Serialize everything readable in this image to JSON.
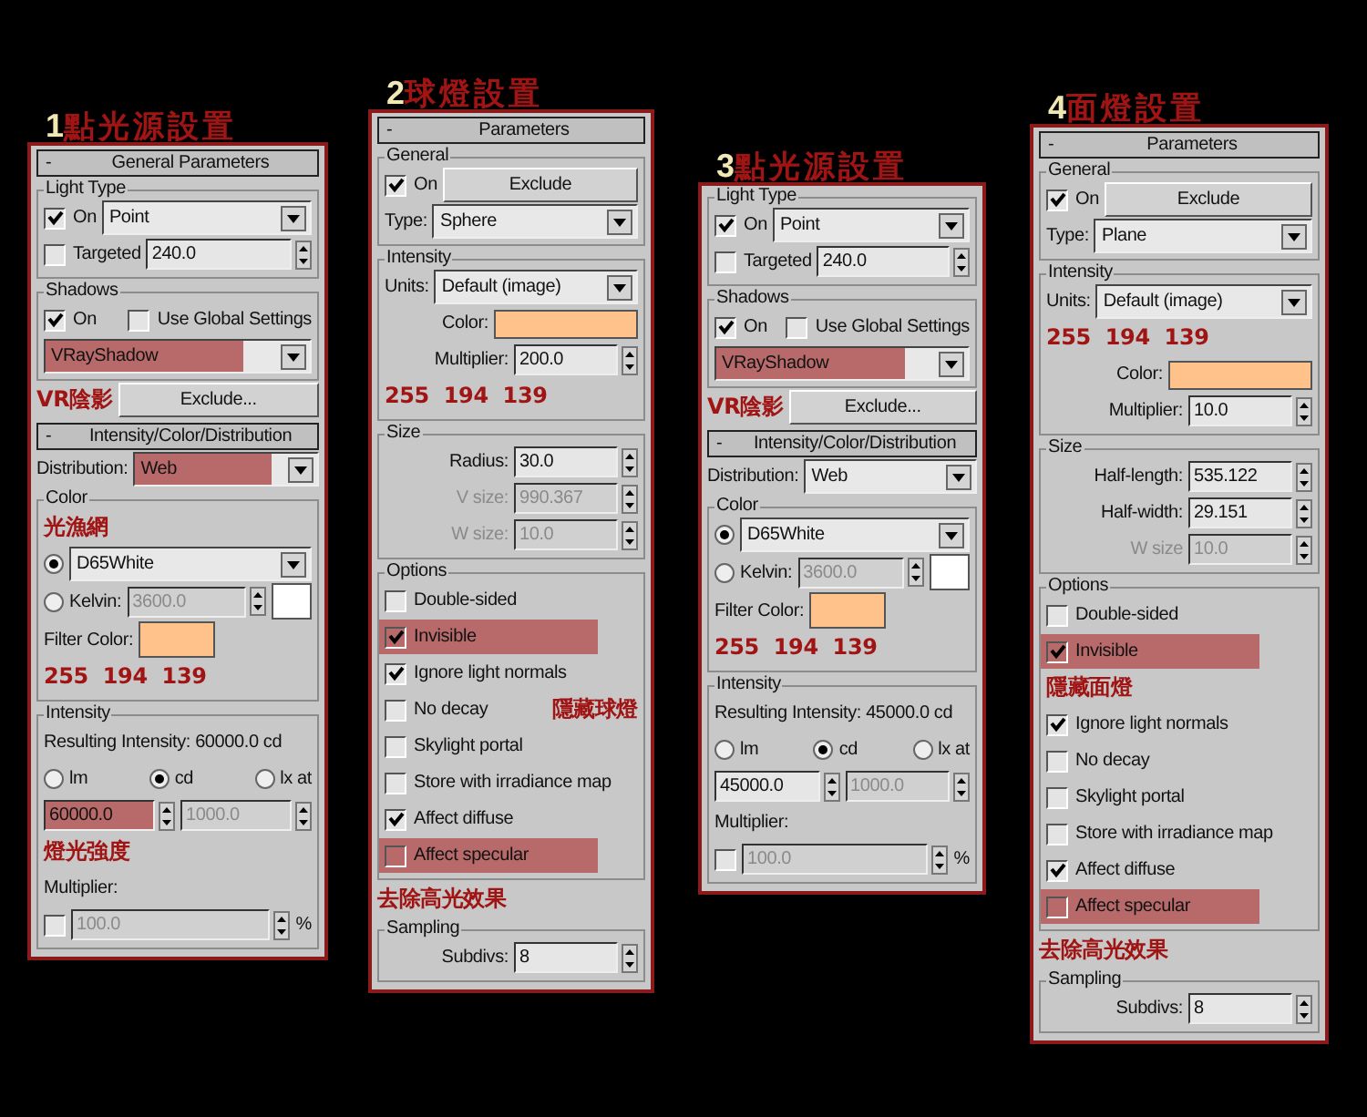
{
  "panels": [
    {
      "number": "1",
      "title": "點光源設置",
      "items": [
        {
          "kind": "rollout",
          "sign": "-",
          "title": "General Parameters"
        },
        {
          "kind": "group",
          "title": "Light Type",
          "lines": [
            {
              "controls": [
                {
                  "kind": "checkbox",
                  "label": "On",
                  "checked": true
                },
                {
                  "kind": "dropdown",
                  "value": "Point"
                }
              ]
            },
            {
              "controls": [
                {
                  "kind": "checkbox",
                  "label": "Targeted",
                  "checked": false
                },
                {
                  "kind": "spinner",
                  "value": "240.0"
                }
              ]
            }
          ]
        },
        {
          "kind": "group",
          "title": "Shadows",
          "lines": [
            {
              "controls": [
                {
                  "kind": "checkbox",
                  "label": "On",
                  "checked": true
                },
                {
                  "kind": "checkbox",
                  "label": "Use Global Settings",
                  "checked": false
                }
              ]
            },
            {
              "controls": [
                {
                  "kind": "dropdown",
                  "value": "VRayShadow",
                  "highlighted": true
                }
              ]
            }
          ]
        },
        {
          "kind": "row",
          "controls": [
            {
              "kind": "note",
              "text": "VR陰影"
            },
            {
              "kind": "button",
              "label": "Exclude..."
            }
          ]
        },
        {
          "kind": "rollout",
          "sign": "-",
          "title": "Intensity/Color/Distribution"
        },
        {
          "kind": "row",
          "controls": [
            {
              "kind": "dropdown",
              "label": "Distribution:",
              "value": "Web",
              "highlighted": true
            }
          ]
        },
        {
          "kind": "group",
          "title": "Color",
          "lines": [
            {
              "controls": [
                {
                  "kind": "note",
                  "text": "光漁網"
                }
              ]
            },
            {
              "controls": [
                {
                  "kind": "radio",
                  "selected": true
                },
                {
                  "kind": "dropdown",
                  "value": "D65White"
                }
              ]
            },
            {
              "controls": [
                {
                  "kind": "radio",
                  "label": "Kelvin:",
                  "selected": false
                },
                {
                  "kind": "spinner",
                  "value": "3600.0",
                  "disabled": true
                },
                {
                  "kind": "swatch",
                  "color": "#ffffff"
                }
              ]
            },
            {
              "controls": [
                {
                  "kind": "swatch",
                  "label": "Filter Color:",
                  "color": "#ffc28b"
                }
              ]
            },
            {
              "controls": [
                {
                  "kind": "note",
                  "text": "255  194  139"
                }
              ]
            }
          ]
        },
        {
          "kind": "group",
          "title": "Intensity",
          "lines": [
            {
              "controls": [
                {
                  "kind": "text",
                  "text": "Resulting Intensity: 60000.0 cd"
                }
              ]
            },
            {
              "controls": [
                {
                  "kind": "radio",
                  "label": "lm",
                  "selected": false
                },
                {
                  "kind": "radio",
                  "label": "cd",
                  "selected": true
                },
                {
                  "kind": "radio",
                  "label": "lx at",
                  "selected": false
                }
              ]
            },
            {
              "controls": [
                {
                  "kind": "spinner",
                  "value": "60000.0",
                  "highlighted": true
                },
                {
                  "kind": "spinner",
                  "value": "1000.0",
                  "disabled": true
                }
              ]
            },
            {
              "controls": [
                {
                  "kind": "note",
                  "text": "燈光強度"
                }
              ]
            },
            {
              "controls": [
                {
                  "kind": "text",
                  "text": "Multiplier:"
                }
              ]
            },
            {
              "controls": [
                {
                  "kind": "checkbox",
                  "checked": false
                },
                {
                  "kind": "spinner",
                  "value": "100.0",
                  "disabled": true
                },
                {
                  "kind": "text",
                  "text": "%"
                }
              ]
            }
          ]
        }
      ]
    },
    {
      "number": "2",
      "title": "球燈設置",
      "items": [
        {
          "kind": "rollout",
          "sign": "-",
          "title": "Parameters"
        },
        {
          "kind": "group",
          "title": "General",
          "lines": [
            {
              "controls": [
                {
                  "kind": "checkbox",
                  "label": "On",
                  "checked": true
                },
                {
                  "kind": "button",
                  "label": "Exclude"
                }
              ]
            },
            {
              "controls": [
                {
                  "kind": "dropdown",
                  "label": "Type:",
                  "value": "Sphere"
                }
              ]
            }
          ]
        },
        {
          "kind": "group",
          "title": "Intensity",
          "lines": [
            {
              "controls": [
                {
                  "kind": "dropdown",
                  "label": "Units:",
                  "value": "Default (image)"
                }
              ]
            },
            {
              "controls": [
                {
                  "kind": "color_field",
                  "label": "Color:",
                  "color": "#ffc28b"
                }
              ]
            },
            {
              "controls": [
                {
                  "kind": "field",
                  "label": "Multiplier:",
                  "value": "200.0"
                }
              ]
            },
            {
              "controls": [
                {
                  "kind": "note",
                  "text": "255  194  139"
                }
              ]
            }
          ]
        },
        {
          "kind": "group",
          "title": "Size",
          "lines": [
            {
              "controls": [
                {
                  "kind": "field",
                  "label": "Radius:",
                  "value": "30.0"
                }
              ]
            },
            {
              "controls": [
                {
                  "kind": "field",
                  "label": "V size:",
                  "value": "990.367",
                  "disabled": true
                }
              ]
            },
            {
              "controls": [
                {
                  "kind": "field",
                  "label": "W size:",
                  "value": "10.0",
                  "disabled": true
                }
              ]
            }
          ]
        },
        {
          "kind": "group",
          "title": "Options",
          "lines": [
            {
              "controls": [
                {
                  "kind": "checkbox",
                  "label": "Double-sided",
                  "checked": false
                }
              ]
            },
            {
              "controls": [
                {
                  "kind": "checkbox",
                  "label": "Invisible",
                  "checked": true,
                  "highlighted": true
                }
              ]
            },
            {
              "controls": [
                {
                  "kind": "checkbox",
                  "label": "Ignore light normals",
                  "checked": true
                }
              ]
            },
            {
              "controls": [
                {
                  "kind": "checkbox",
                  "label": "No decay",
                  "checked": false
                },
                {
                  "kind": "note",
                  "text": "隱藏球燈"
                }
              ]
            },
            {
              "controls": [
                {
                  "kind": "checkbox",
                  "label": "Skylight portal",
                  "checked": false
                }
              ]
            },
            {
              "controls": [
                {
                  "kind": "checkbox",
                  "label": "Store with irradiance map",
                  "checked": false
                }
              ]
            },
            {
              "controls": [
                {
                  "kind": "checkbox",
                  "label": "Affect diffuse",
                  "checked": true
                }
              ]
            },
            {
              "controls": [
                {
                  "kind": "checkbox",
                  "label": "Affect specular",
                  "checked": false,
                  "highlighted": true
                }
              ]
            }
          ]
        },
        {
          "kind": "row",
          "controls": [
            {
              "kind": "note",
              "text": "去除高光效果"
            }
          ]
        },
        {
          "kind": "group",
          "title": "Sampling",
          "lines": [
            {
              "controls": [
                {
                  "kind": "field",
                  "label": "Subdivs:",
                  "value": "8"
                }
              ]
            }
          ]
        }
      ]
    },
    {
      "number": "3",
      "title": "點光源設置",
      "items": [
        {
          "kind": "group",
          "title": "Light Type",
          "lines": [
            {
              "controls": [
                {
                  "kind": "checkbox",
                  "label": "On",
                  "checked": true
                },
                {
                  "kind": "dropdown",
                  "value": "Point"
                }
              ]
            },
            {
              "controls": [
                {
                  "kind": "checkbox",
                  "label": "Targeted",
                  "checked": false
                },
                {
                  "kind": "spinner",
                  "value": "240.0"
                }
              ]
            }
          ]
        },
        {
          "kind": "group",
          "title": "Shadows",
          "lines": [
            {
              "controls": [
                {
                  "kind": "checkbox",
                  "label": "On",
                  "checked": true
                },
                {
                  "kind": "checkbox",
                  "label": "Use Global Settings",
                  "checked": false
                }
              ]
            },
            {
              "controls": [
                {
                  "kind": "dropdown",
                  "value": "VRayShadow",
                  "highlighted": true
                }
              ]
            }
          ]
        },
        {
          "kind": "row",
          "controls": [
            {
              "kind": "note",
              "text": "VR陰影"
            },
            {
              "kind": "button",
              "label": "Exclude..."
            }
          ]
        },
        {
          "kind": "rollout",
          "sign": "-",
          "title": "Intensity/Color/Distribution"
        },
        {
          "kind": "row",
          "controls": [
            {
              "kind": "dropdown",
              "label": "Distribution:",
              "value": "Web"
            }
          ]
        },
        {
          "kind": "group",
          "title": "Color",
          "lines": [
            {
              "controls": [
                {
                  "kind": "radio",
                  "selected": true
                },
                {
                  "kind": "dropdown",
                  "value": "D65White"
                }
              ]
            },
            {
              "controls": [
                {
                  "kind": "radio",
                  "label": "Kelvin:",
                  "selected": false
                },
                {
                  "kind": "spinner",
                  "value": "3600.0",
                  "disabled": true
                },
                {
                  "kind": "swatch",
                  "color": "#ffffff"
                }
              ]
            },
            {
              "controls": [
                {
                  "kind": "swatch",
                  "label": "Filter Color:",
                  "color": "#ffc28b"
                }
              ]
            },
            {
              "controls": [
                {
                  "kind": "note",
                  "text": "255  194  139"
                }
              ]
            }
          ]
        },
        {
          "kind": "group",
          "title": "Intensity",
          "lines": [
            {
              "controls": [
                {
                  "kind": "text",
                  "text": "Resulting Intensity: 45000.0 cd"
                }
              ]
            },
            {
              "controls": [
                {
                  "kind": "radio",
                  "label": "lm",
                  "selected": false
                },
                {
                  "kind": "radio",
                  "label": "cd",
                  "selected": true
                },
                {
                  "kind": "radio",
                  "label": "lx at",
                  "selected": false
                }
              ]
            },
            {
              "controls": [
                {
                  "kind": "spinner",
                  "value": "45000.0"
                },
                {
                  "kind": "spinner",
                  "value": "1000.0",
                  "disabled": true
                }
              ]
            },
            {
              "controls": [
                {
                  "kind": "text",
                  "text": "Multiplier:"
                }
              ]
            },
            {
              "controls": [
                {
                  "kind": "checkbox",
                  "checked": false
                },
                {
                  "kind": "spinner",
                  "value": "100.0",
                  "disabled": true
                },
                {
                  "kind": "text",
                  "text": "%"
                }
              ]
            }
          ]
        }
      ]
    },
    {
      "number": "4",
      "title": "面燈設置",
      "items": [
        {
          "kind": "rollout",
          "sign": "-",
          "title": "Parameters"
        },
        {
          "kind": "group",
          "title": "General",
          "lines": [
            {
              "controls": [
                {
                  "kind": "checkbox",
                  "label": "On",
                  "checked": true
                },
                {
                  "kind": "button",
                  "label": "Exclude"
                }
              ]
            },
            {
              "controls": [
                {
                  "kind": "dropdown",
                  "label": "Type:",
                  "value": "Plane"
                }
              ]
            }
          ]
        },
        {
          "kind": "group",
          "title": "Intensity",
          "lines": [
            {
              "controls": [
                {
                  "kind": "dropdown",
                  "label": "Units:",
                  "value": "Default (image)"
                }
              ]
            },
            {
              "controls": [
                {
                  "kind": "note",
                  "text": "255  194  139"
                }
              ]
            },
            {
              "controls": [
                {
                  "kind": "color_field",
                  "label": "Color:",
                  "color": "#ffc28b"
                }
              ]
            },
            {
              "controls": [
                {
                  "kind": "field",
                  "label": "Multiplier:",
                  "value": "10.0"
                }
              ]
            }
          ]
        },
        {
          "kind": "group",
          "title": "Size",
          "lines": [
            {
              "controls": [
                {
                  "kind": "field",
                  "label": "Half-length:",
                  "value": "535.122"
                }
              ]
            },
            {
              "controls": [
                {
                  "kind": "field",
                  "label": "Half-width:",
                  "value": "29.151"
                }
              ]
            },
            {
              "controls": [
                {
                  "kind": "field",
                  "label": "W size",
                  "value": "10.0",
                  "disabled": true
                }
              ]
            }
          ]
        },
        {
          "kind": "group",
          "title": "Options",
          "lines": [
            {
              "controls": [
                {
                  "kind": "checkbox",
                  "label": "Double-sided",
                  "checked": false
                }
              ]
            },
            {
              "controls": [
                {
                  "kind": "checkbox",
                  "label": "Invisible",
                  "checked": true,
                  "highlighted": true
                }
              ]
            },
            {
              "controls": [
                {
                  "kind": "note",
                  "text": "隱藏面燈"
                }
              ]
            },
            {
              "controls": [
                {
                  "kind": "checkbox",
                  "label": "Ignore light normals",
                  "checked": true
                }
              ]
            },
            {
              "controls": [
                {
                  "kind": "checkbox",
                  "label": "No decay",
                  "checked": false
                }
              ]
            },
            {
              "controls": [
                {
                  "kind": "checkbox",
                  "label": "Skylight portal",
                  "checked": false
                }
              ]
            },
            {
              "controls": [
                {
                  "kind": "checkbox",
                  "label": "Store with irradiance map",
                  "checked": false
                }
              ]
            },
            {
              "controls": [
                {
                  "kind": "checkbox",
                  "label": "Affect diffuse",
                  "checked": true
                }
              ]
            },
            {
              "controls": [
                {
                  "kind": "checkbox",
                  "label": "Affect specular",
                  "checked": false,
                  "highlighted": true
                }
              ]
            }
          ]
        },
        {
          "kind": "row",
          "controls": [
            {
              "kind": "note",
              "text": "去除高光效果"
            }
          ]
        },
        {
          "kind": "group",
          "title": "Sampling",
          "lines": [
            {
              "controls": [
                {
                  "kind": "field",
                  "label": "Subdivs:",
                  "value": "8"
                }
              ]
            }
          ]
        }
      ]
    }
  ]
}
